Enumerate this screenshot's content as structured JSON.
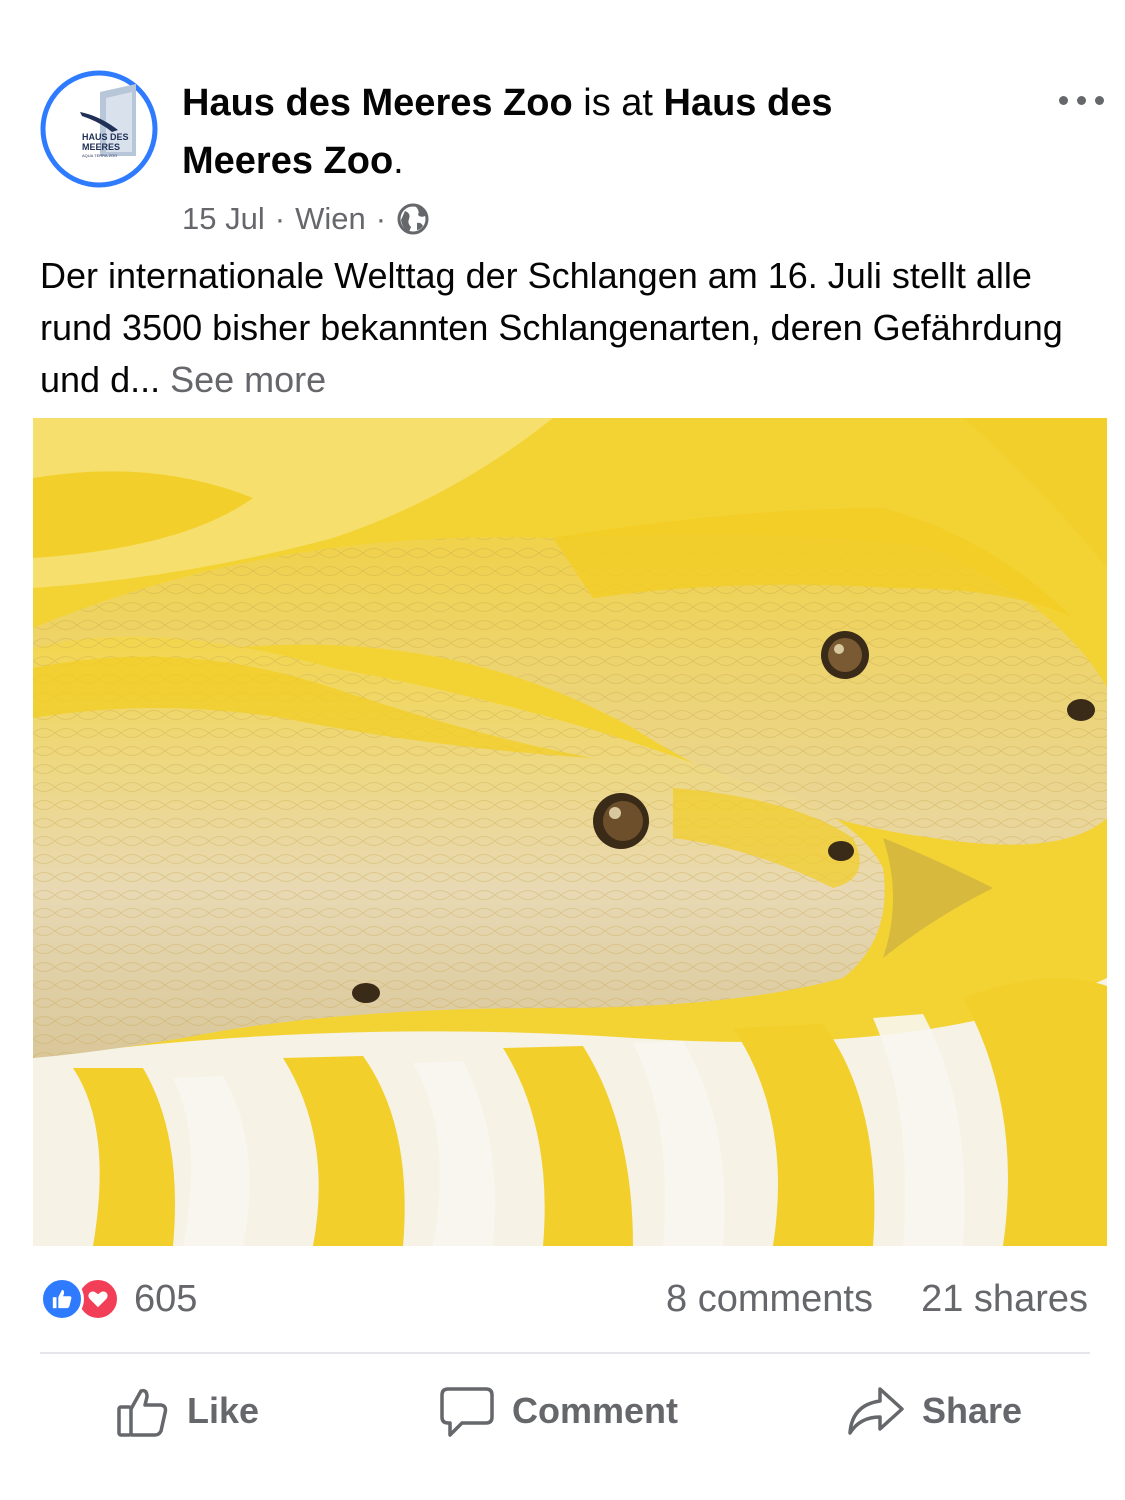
{
  "post": {
    "page_name": "Haus des Meeres Zoo",
    "connector": " is at ",
    "location_name": "Haus des Meeres Zoo",
    "location_suffix": ".",
    "date": "15 Jul",
    "separator": "·",
    "city": "Wien",
    "privacy_icon": "globe-icon",
    "caption": "Der internationale Welttag der Schlangen am 16. Juli stellt alle rund 3500 bisher bekannten Schlangenarten, deren Gefährdung und d...",
    "see_more_label": "See more"
  },
  "avatar": {
    "logo_line1": "HAUS DES",
    "logo_line2": "MEERES",
    "logo_line3": "AQUA TERRA ZOO",
    "ring_color": "#2f7bff"
  },
  "photo": {
    "subject": "Two albino pythons (yellow and white)",
    "colors": {
      "yellow": "#f2d12e",
      "cream": "#f1e6c6",
      "white": "#f7f5ee"
    }
  },
  "stats": {
    "reaction_icons": [
      "like-icon",
      "love-icon"
    ],
    "reaction_count": "605",
    "comments": "8 comments",
    "shares": "21 shares"
  },
  "actions": {
    "like_label": "Like",
    "comment_label": "Comment",
    "share_label": "Share"
  },
  "colors": {
    "text_primary": "#050505",
    "text_secondary": "#65676b",
    "like_blue": "#2f7bff",
    "love_red": "#f33e58",
    "divider": "#e4e6eb"
  }
}
